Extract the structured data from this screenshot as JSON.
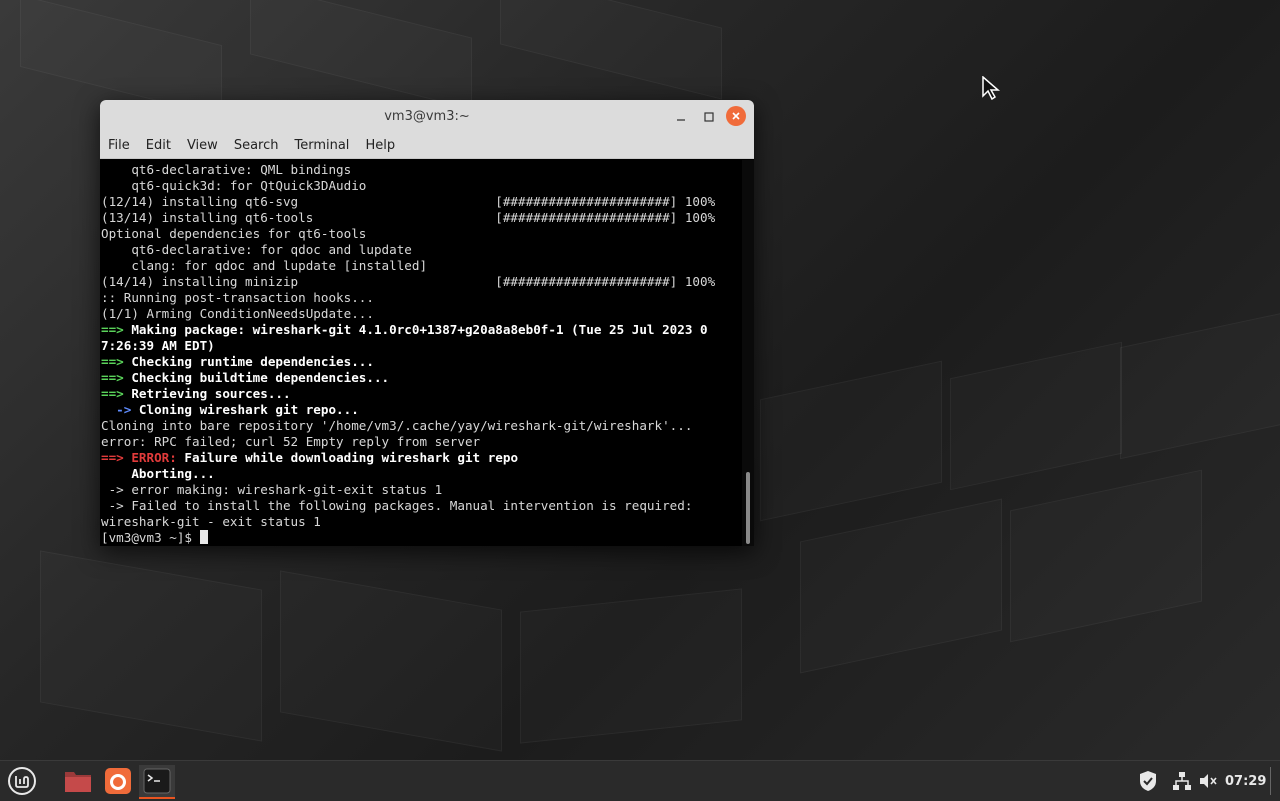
{
  "window": {
    "title": "vm3@vm3:~",
    "menu": [
      "File",
      "Edit",
      "View",
      "Search",
      "Terminal",
      "Help"
    ]
  },
  "terminal": {
    "lines": [
      [
        {
          "t": "    qt6-declarative: QML bindings"
        }
      ],
      [
        {
          "t": "    qt6-quick3d: for QtQuick3DAudio"
        }
      ],
      [
        {
          "t": "(12/14) installing qt6-svg                          [######################] 100%"
        }
      ],
      [
        {
          "t": "(13/14) installing qt6-tools                        [######################] 100%"
        }
      ],
      [
        {
          "t": "Optional dependencies for qt6-tools"
        }
      ],
      [
        {
          "t": "    qt6-declarative: for qdoc and lupdate"
        }
      ],
      [
        {
          "t": "    clang: for qdoc and lupdate [installed]"
        }
      ],
      [
        {
          "t": "(14/14) installing minizip                          [######################] 100%"
        }
      ],
      [
        {
          "t": ":: Running post-transaction hooks..."
        }
      ],
      [
        {
          "t": "(1/1) Arming ConditionNeedsUpdate..."
        }
      ],
      [
        {
          "t": "==> ",
          "c": "g"
        },
        {
          "t": "Making package: wireshark-git 4.1.0rc0+1387+g20a8a8eb0f-1 (Tue 25 Jul 2023 0",
          "c": "w"
        }
      ],
      [
        {
          "t": "7:26:39 AM EDT)",
          "c": "w"
        }
      ],
      [
        {
          "t": "==> ",
          "c": "g"
        },
        {
          "t": "Checking runtime dependencies...",
          "c": "w"
        }
      ],
      [
        {
          "t": "==> ",
          "c": "g"
        },
        {
          "t": "Checking buildtime dependencies...",
          "c": "w"
        }
      ],
      [
        {
          "t": "==> ",
          "c": "g"
        },
        {
          "t": "Retrieving sources...",
          "c": "w"
        }
      ],
      [
        {
          "t": "  -> ",
          "c": "b"
        },
        {
          "t": "Cloning wireshark git repo...",
          "c": "w"
        }
      ],
      [
        {
          "t": "Cloning into bare repository '/home/vm3/.cache/yay/wireshark-git/wireshark'..."
        }
      ],
      [
        {
          "t": "error: RPC failed; curl 52 Empty reply from server"
        }
      ],
      [
        {
          "t": "==> ",
          "c": "r"
        },
        {
          "t": "ERROR: ",
          "c": "r"
        },
        {
          "t": "Failure while downloading wireshark git repo",
          "c": "w"
        }
      ],
      [
        {
          "t": "    Aborting...",
          "c": "w"
        }
      ],
      [
        {
          "t": " -> error making: wireshark-git-exit status 1"
        }
      ],
      [
        {
          "t": " -> Failed to install the following packages. Manual intervention is required:"
        }
      ],
      [
        {
          "t": "wireshark-git - exit status 1"
        }
      ]
    ],
    "prompt": "[vm3@vm3 ~]$ "
  },
  "taskbar": {
    "clock": "07:29",
    "items": [
      "menu-icon",
      "files-icon",
      "firefox-icon",
      "terminal-icon"
    ]
  },
  "colors": {
    "accent": "#e95420",
    "green": "#5ad35a",
    "blue": "#5f8cff",
    "red": "#e23b3b"
  }
}
